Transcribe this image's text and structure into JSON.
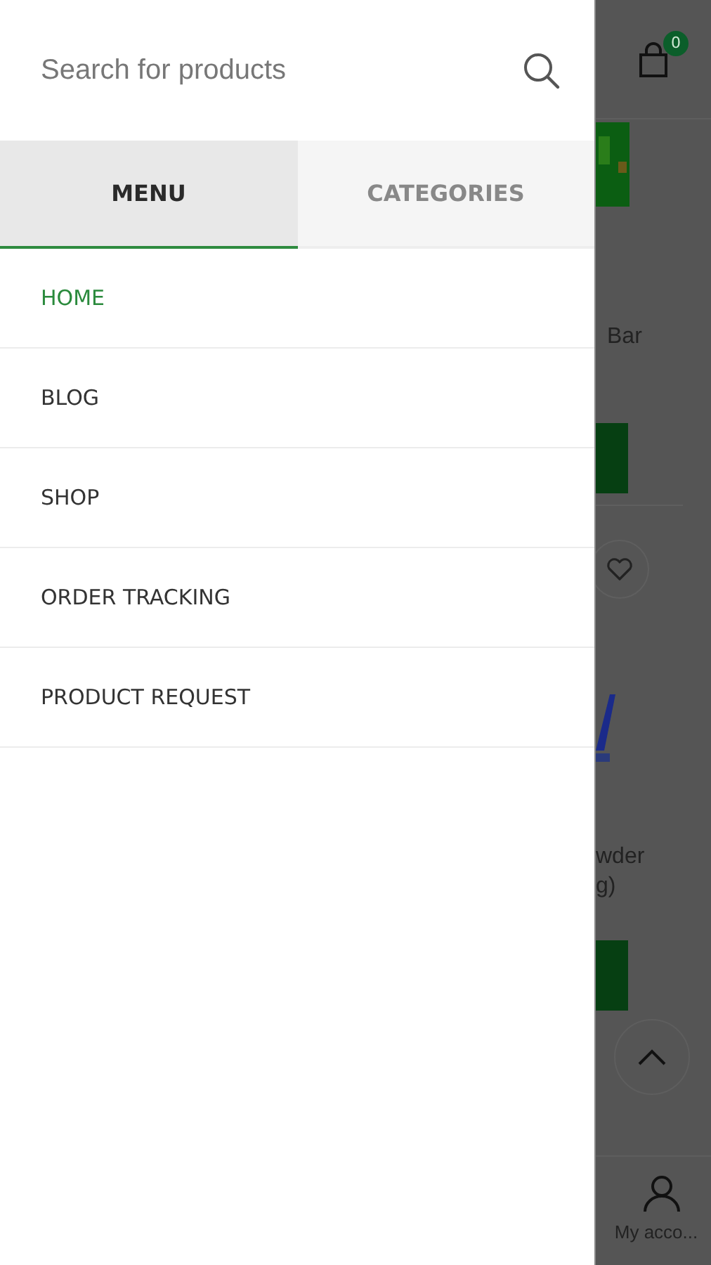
{
  "search": {
    "placeholder": "Search for products"
  },
  "tabs": [
    {
      "label": "MENU",
      "selected": true
    },
    {
      "label": "CATEGORIES",
      "selected": false
    }
  ],
  "menu_items": [
    {
      "label": "HOME",
      "selected": true
    },
    {
      "label": "BLOG",
      "selected": false
    },
    {
      "label": "SHOP",
      "selected": false
    },
    {
      "label": "ORDER TRACKING",
      "selected": false
    },
    {
      "label": "PRODUCT REQUEST",
      "selected": false
    }
  ],
  "background_page": {
    "cart_count": "0",
    "product_title_1": "Bar",
    "product_title_2": [
      "wder",
      "g)"
    ],
    "account_label": "My acco..."
  }
}
